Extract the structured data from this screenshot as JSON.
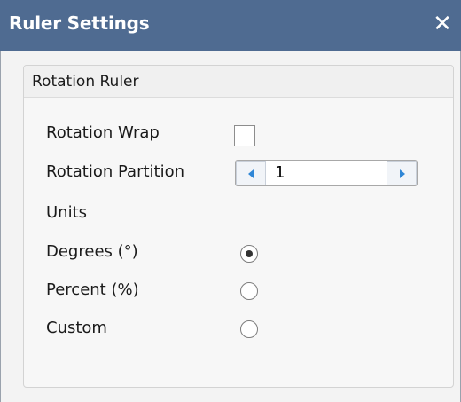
{
  "window": {
    "title": "Ruler Settings",
    "close_icon": "close-icon",
    "titlebar_color": "#4f6b91"
  },
  "group": {
    "title": "Rotation Ruler"
  },
  "rotation_wrap": {
    "label": "Rotation Wrap",
    "checked": false
  },
  "rotation_partition": {
    "label": "Rotation Partition",
    "value": "1",
    "decrement_icon": "arrow-left-icon",
    "increment_icon": "arrow-right-icon",
    "arrow_color": "#2f86d6"
  },
  "units": {
    "label": "Units",
    "options": [
      {
        "label": "Degrees (°)",
        "selected": true
      },
      {
        "label": "Percent (%)",
        "selected": false
      },
      {
        "label": "Custom",
        "selected": false
      }
    ]
  }
}
